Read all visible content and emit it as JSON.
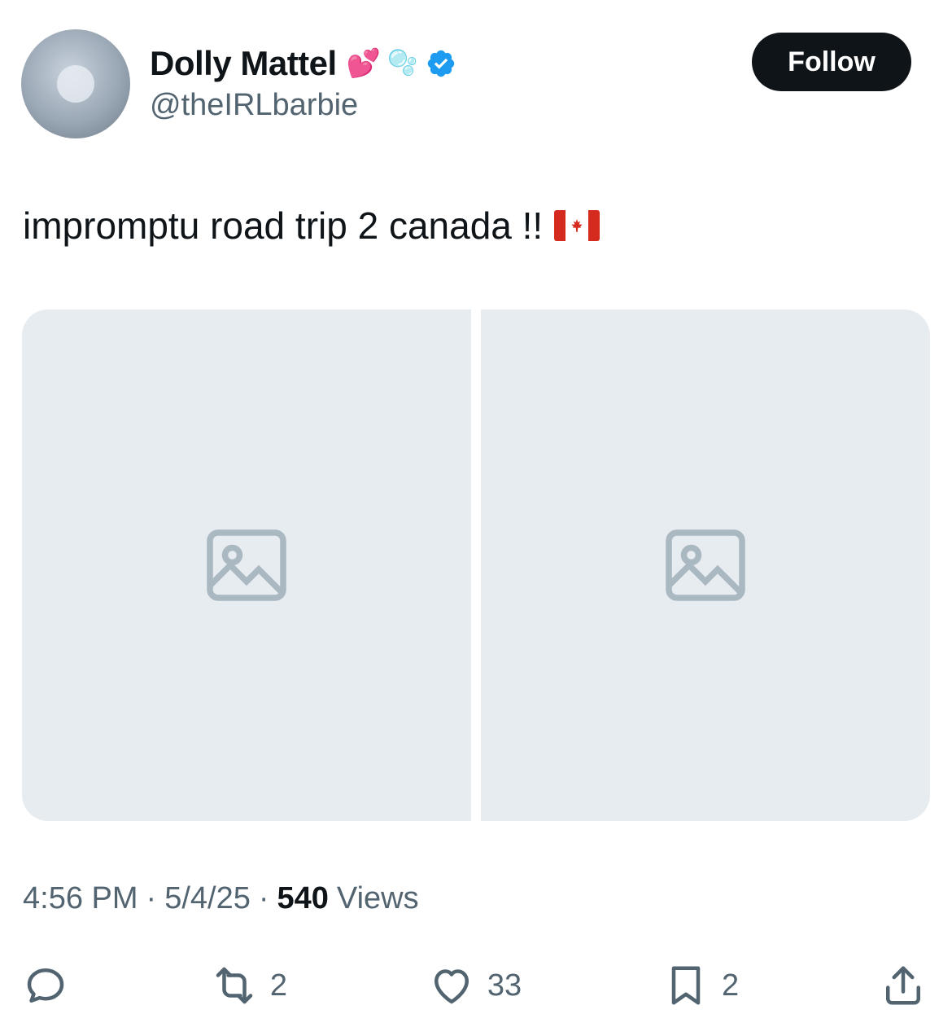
{
  "author": {
    "display_name": "Dolly Mattel",
    "handle": "@theIRLbarbie",
    "name_emojis": [
      "💕",
      "🫧"
    ],
    "verified": true
  },
  "follow_label": "Follow",
  "tweet": {
    "text": "impromptu road trip 2 canada !!",
    "flag_emoji": "🇨🇦",
    "media_count": 2
  },
  "meta": {
    "time": "4:56 PM",
    "separator": "·",
    "date": "5/4/25",
    "views_count": "540",
    "views_label": "Views"
  },
  "actions": {
    "reply": {
      "icon": "reply-icon",
      "count": ""
    },
    "retweet": {
      "icon": "retweet-icon",
      "count": "2"
    },
    "like": {
      "icon": "heart-icon",
      "count": "33"
    },
    "bookmark": {
      "icon": "bookmark-icon",
      "count": "2"
    },
    "share": {
      "icon": "share-icon",
      "count": ""
    }
  },
  "colors": {
    "text_primary": "#0f1419",
    "text_secondary": "#536471",
    "verified_blue": "#1d9bf0",
    "follow_bg": "#0f1419"
  }
}
